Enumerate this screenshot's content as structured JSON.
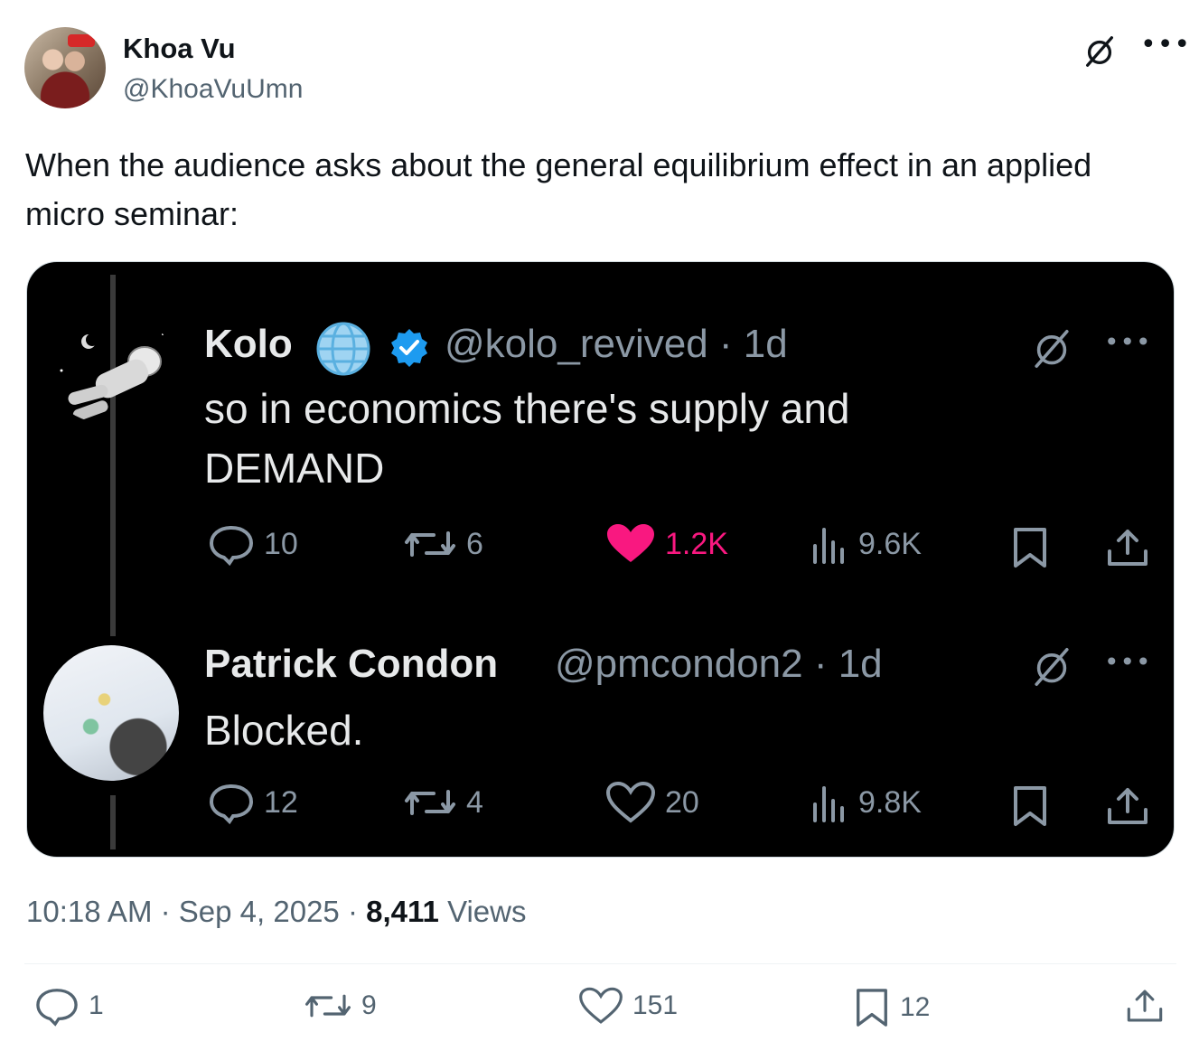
{
  "author": {
    "name": "Khoa Vu",
    "handle": "@KhoaVuUmn"
  },
  "tweet": {
    "text": "When the audience asks about the general equilibrium effect in an applied micro seminar:",
    "time": "10:18 AM",
    "date": "Sep 4, 2025",
    "views_count": "8,411",
    "views_label": "Views",
    "separator": "·"
  },
  "screenshot": {
    "post1": {
      "name": "Kolo",
      "handle": "@kolo_revived · 1d",
      "text_line1": "so in economics there's supply and",
      "text_line2": "DEMAND",
      "replies": "10",
      "reposts": "6",
      "likes": "1.2K",
      "views": "9.6K"
    },
    "post2": {
      "name": "Patrick Condon",
      "handle": "@pmcondon2 · 1d",
      "text": "Blocked.",
      "replies": "12",
      "reposts": "4",
      "likes": "20",
      "views": "9.8K"
    }
  },
  "actions": {
    "replies": "1",
    "reposts": "9",
    "likes": "151",
    "bookmarks": "12"
  },
  "colors": {
    "text_primary": "#0f1419",
    "text_secondary": "#536471",
    "like_pink": "#f91880",
    "verified_blue": "#1d9bf0"
  }
}
